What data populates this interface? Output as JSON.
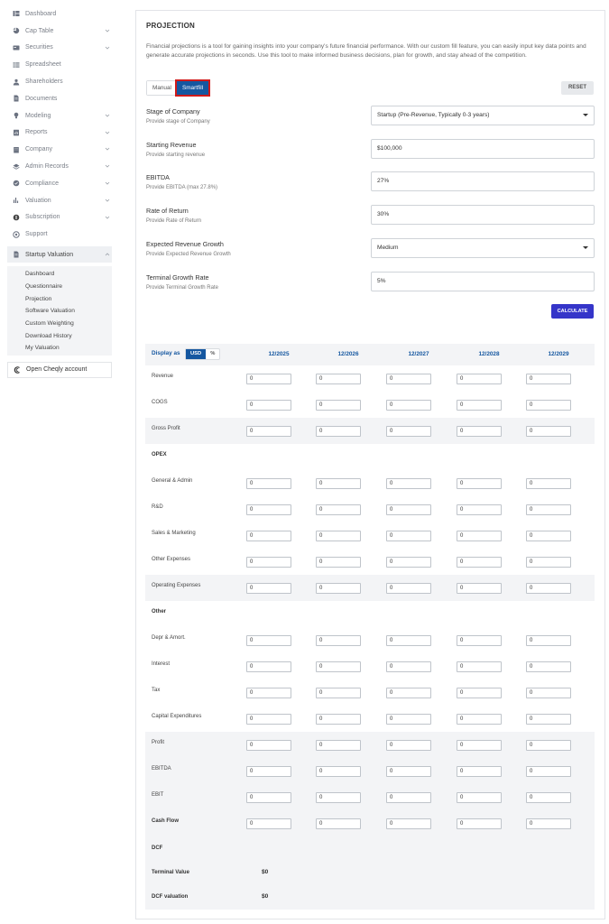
{
  "sidebar": {
    "items": [
      {
        "label": "Dashboard",
        "icon": "dashboard-icon",
        "chevron": false
      },
      {
        "label": "Cap Table",
        "icon": "pie-chart-icon",
        "chevron": true
      },
      {
        "label": "Securities",
        "icon": "securities-icon",
        "chevron": true
      },
      {
        "label": "Spreadsheet",
        "icon": "spreadsheet-icon",
        "chevron": false
      },
      {
        "label": "Shareholders",
        "icon": "user-icon",
        "chevron": false
      },
      {
        "label": "Documents",
        "icon": "document-icon",
        "chevron": false
      },
      {
        "label": "Modeling",
        "icon": "bulb-icon",
        "chevron": true
      },
      {
        "label": "Reports",
        "icon": "report-icon",
        "chevron": true
      },
      {
        "label": "Company",
        "icon": "building-icon",
        "chevron": true
      },
      {
        "label": "Admin Records",
        "icon": "records-icon",
        "chevron": true
      },
      {
        "label": "Compliance",
        "icon": "compliance-icon",
        "chevron": true
      },
      {
        "label": "Valuation",
        "icon": "valuation-icon",
        "chevron": true
      },
      {
        "label": "Subscription",
        "icon": "subscription-icon",
        "chevron": true
      },
      {
        "label": "Support",
        "icon": "support-icon",
        "chevron": false
      }
    ],
    "active": {
      "label": "Startup Valuation",
      "icon": "document-icon"
    },
    "subitems": [
      "Dashboard",
      "Questionnaire",
      "Projection",
      "Software Valuation",
      "Custom Weighting",
      "Download History",
      "My Valuation"
    ],
    "open_account": "Open Cheqly account"
  },
  "main": {
    "title": "PROJECTION",
    "description": "Financial projections is a tool for gaining insights into your company's future financial performance. With our custom fill feature, you can easily input key data points and generate accurate projections in seconds. Use this tool to make informed business decisions, plan for growth, and stay ahead of the competition.",
    "mode_manual": "Manual",
    "mode_smartfill": "Smartfill",
    "reset_label": "RESET",
    "calculate_label": "CALCULATE",
    "fields": [
      {
        "label": "Stage of Company",
        "sub": "Provide stage of Company",
        "value": "Startup (Pre-Revenue, Typically 0-3 years)",
        "dropdown": true
      },
      {
        "label": "Starting Revenue",
        "sub": "Provide starting revenue",
        "value": "$100,000",
        "dropdown": false
      },
      {
        "label": "EBITDA",
        "sub": "Provide EBITDA (max 27.8%)",
        "value": "27%",
        "dropdown": false
      },
      {
        "label": "Rate of Return",
        "sub": "Provide Rate of Return",
        "value": "30%",
        "dropdown": false
      },
      {
        "label": "Expected Revenue Growth",
        "sub": "Provide Expected Revenue Growth",
        "value": "Medium",
        "dropdown": true
      },
      {
        "label": "Terminal Growth Rate",
        "sub": "Provide Terminal Growth Rate",
        "value": "5%",
        "dropdown": false
      }
    ]
  },
  "table": {
    "display_as": "Display as",
    "currency_usd": "USD",
    "currency_pct": "%",
    "years": [
      "12/2025",
      "12/2026",
      "12/2027",
      "12/2028",
      "12/2029"
    ],
    "rows": [
      {
        "label": "Revenue",
        "type": "input",
        "values": [
          "0",
          "0",
          "0",
          "0",
          "0"
        ],
        "alt": false,
        "bold": false
      },
      {
        "label": "COGS",
        "type": "input",
        "values": [
          "0",
          "0",
          "0",
          "0",
          "0"
        ],
        "alt": false,
        "bold": false
      },
      {
        "label": "Gross Profit",
        "type": "input",
        "values": [
          "0",
          "0",
          "0",
          "0",
          "0"
        ],
        "alt": true,
        "bold": false
      },
      {
        "label": "OPEX",
        "type": "header",
        "values": [],
        "alt": false,
        "bold": true
      },
      {
        "label": "General & Admin",
        "type": "input",
        "values": [
          "0",
          "0",
          "0",
          "0",
          "0"
        ],
        "alt": false,
        "bold": false
      },
      {
        "label": "R&D",
        "type": "input",
        "values": [
          "0",
          "0",
          "0",
          "0",
          "0"
        ],
        "alt": false,
        "bold": false
      },
      {
        "label": "Sales & Marketing",
        "type": "input",
        "values": [
          "0",
          "0",
          "0",
          "0",
          "0"
        ],
        "alt": false,
        "bold": false
      },
      {
        "label": "Other Expenses",
        "type": "input",
        "values": [
          "0",
          "0",
          "0",
          "0",
          "0"
        ],
        "alt": false,
        "bold": false
      },
      {
        "label": "Operating Expenses",
        "type": "input",
        "values": [
          "0",
          "0",
          "0",
          "0",
          "0"
        ],
        "alt": true,
        "bold": false
      },
      {
        "label": "Other",
        "type": "header",
        "values": [],
        "alt": false,
        "bold": true
      },
      {
        "label": "Depr & Amort.",
        "type": "input",
        "values": [
          "0",
          "0",
          "0",
          "0",
          "0"
        ],
        "alt": false,
        "bold": false
      },
      {
        "label": "Interest",
        "type": "input",
        "values": [
          "0",
          "0",
          "0",
          "0",
          "0"
        ],
        "alt": false,
        "bold": false
      },
      {
        "label": "Tax",
        "type": "input",
        "values": [
          "0",
          "0",
          "0",
          "0",
          "0"
        ],
        "alt": false,
        "bold": false
      },
      {
        "label": "Capital Expenditures",
        "type": "input",
        "values": [
          "0",
          "0",
          "0",
          "0",
          "0"
        ],
        "alt": false,
        "bold": false
      },
      {
        "label": "Profit",
        "type": "input",
        "values": [
          "0",
          "0",
          "0",
          "0",
          "0"
        ],
        "alt": true,
        "bold": false
      },
      {
        "label": "EBITDA",
        "type": "input",
        "values": [
          "0",
          "0",
          "0",
          "0",
          "0"
        ],
        "alt": true,
        "bold": false
      },
      {
        "label": "EBIT",
        "type": "input",
        "values": [
          "0",
          "0",
          "0",
          "0",
          "0"
        ],
        "alt": true,
        "bold": false
      },
      {
        "label": "Cash Flow",
        "type": "input",
        "values": [
          "0",
          "0",
          "0",
          "0",
          "0"
        ],
        "alt": true,
        "bold": true
      }
    ],
    "dcf": {
      "heading": "DCF",
      "terminal_label": "Terminal Value",
      "terminal_value": "$0",
      "dcf_label": "DCF valuation",
      "dcf_value": "$0"
    }
  }
}
